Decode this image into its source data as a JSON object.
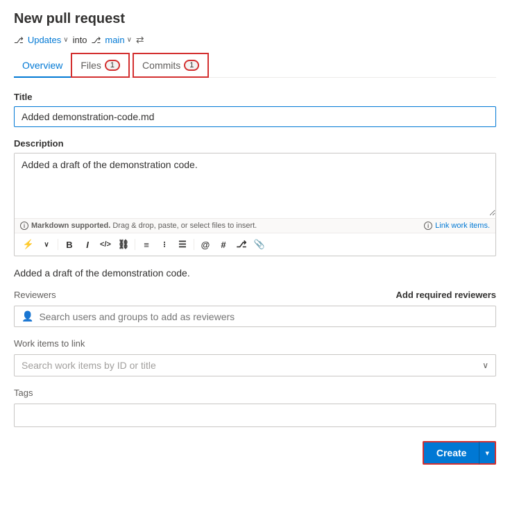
{
  "page": {
    "title": "New pull request",
    "branch_from": "Updates",
    "branch_into": "into",
    "branch_to": "main",
    "swap_symbol": "⇄"
  },
  "tabs": [
    {
      "id": "overview",
      "label": "Overview",
      "badge": null,
      "active": true
    },
    {
      "id": "files",
      "label": "Files",
      "badge": "1",
      "active": false
    },
    {
      "id": "commits",
      "label": "Commits",
      "badge": "1",
      "active": false
    }
  ],
  "form": {
    "title_label": "Title",
    "title_value": "Added demonstration-code.md",
    "description_label": "Description",
    "description_value": "Added a draft of the demonstration code.",
    "markdown_hint": "Markdown supported.",
    "drag_hint": "Drag & drop, paste, or select files to insert.",
    "link_work_items_label": "Link work items.",
    "preview_text": "Added a draft of the demonstration code.",
    "reviewers_label": "Reviewers",
    "add_reviewers_label": "Add required reviewers",
    "reviewers_placeholder": "Search users and groups to add as reviewers",
    "work_items_label": "Work items to link",
    "work_items_placeholder": "Search work items by ID or title",
    "tags_label": "Tags"
  },
  "toolbar": {
    "buttons": [
      "⚡",
      "∨",
      "B",
      "I",
      "</>",
      "🔗",
      "≡",
      "•≡",
      "≡•",
      "@",
      "#",
      "⎇",
      "📎"
    ]
  },
  "actions": {
    "create_label": "Create",
    "chevron_label": "▾"
  },
  "colors": {
    "accent": "#0078d4",
    "red_border": "#d32f2f"
  }
}
